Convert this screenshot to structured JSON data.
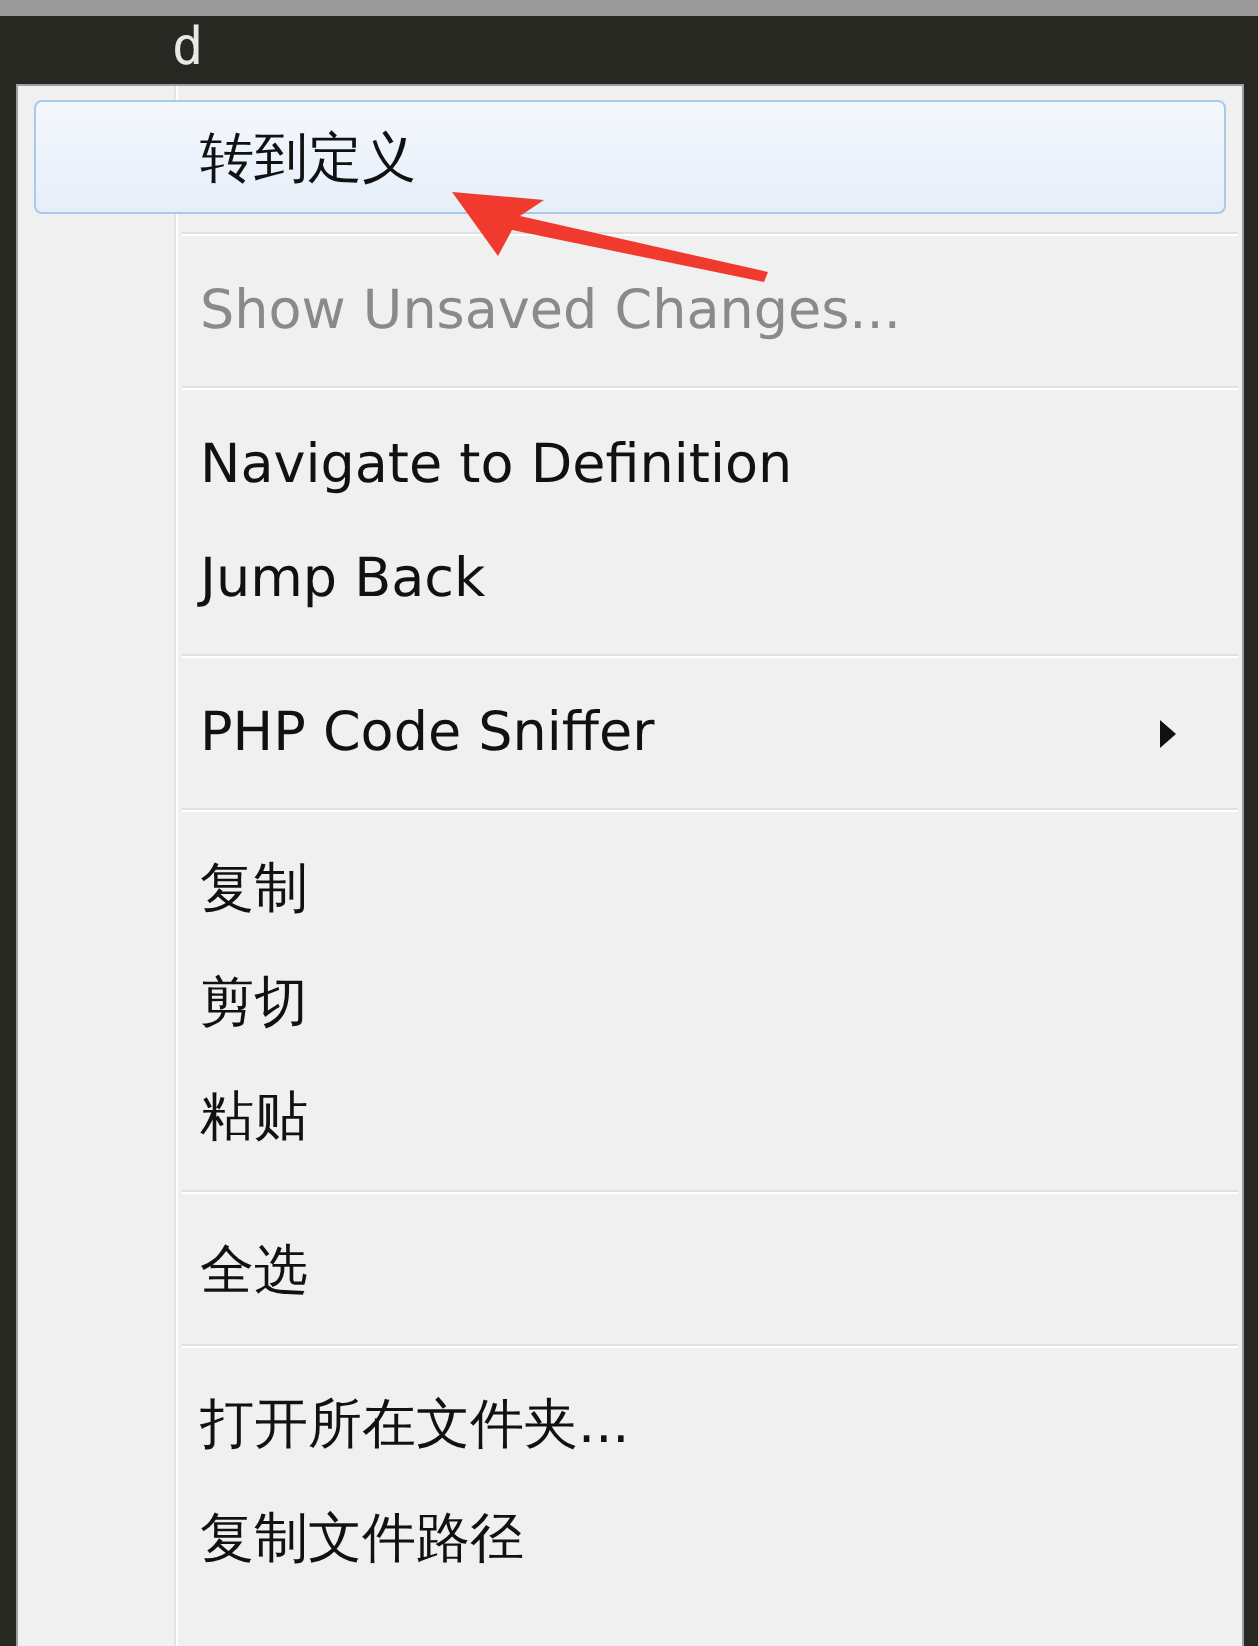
{
  "editor": {
    "code_text": "d"
  },
  "context_menu": {
    "items": [
      {
        "kind": "item",
        "label": "转到定义",
        "selected": true,
        "disabled": false,
        "submenu": false
      },
      {
        "kind": "separator"
      },
      {
        "kind": "item",
        "label": "Show Unsaved Changes...",
        "selected": false,
        "disabled": true,
        "submenu": false
      },
      {
        "kind": "separator"
      },
      {
        "kind": "item",
        "label": "Navigate to Definition",
        "selected": false,
        "disabled": false,
        "submenu": false
      },
      {
        "kind": "item",
        "label": "Jump Back",
        "selected": false,
        "disabled": false,
        "submenu": false
      },
      {
        "kind": "separator"
      },
      {
        "kind": "item",
        "label": "PHP Code Sniffer",
        "selected": false,
        "disabled": false,
        "submenu": true
      },
      {
        "kind": "separator"
      },
      {
        "kind": "item",
        "label": "复制",
        "selected": false,
        "disabled": false,
        "submenu": false
      },
      {
        "kind": "item",
        "label": "剪切",
        "selected": false,
        "disabled": false,
        "submenu": false
      },
      {
        "kind": "item",
        "label": "粘贴",
        "selected": false,
        "disabled": false,
        "submenu": false
      },
      {
        "kind": "separator"
      },
      {
        "kind": "item",
        "label": "全选",
        "selected": false,
        "disabled": false,
        "submenu": false
      },
      {
        "kind": "separator"
      },
      {
        "kind": "item",
        "label": "打开所在文件夹...",
        "selected": false,
        "disabled": false,
        "submenu": false
      },
      {
        "kind": "item",
        "label": "复制文件路径",
        "selected": false,
        "disabled": false,
        "submenu": false
      }
    ]
  }
}
